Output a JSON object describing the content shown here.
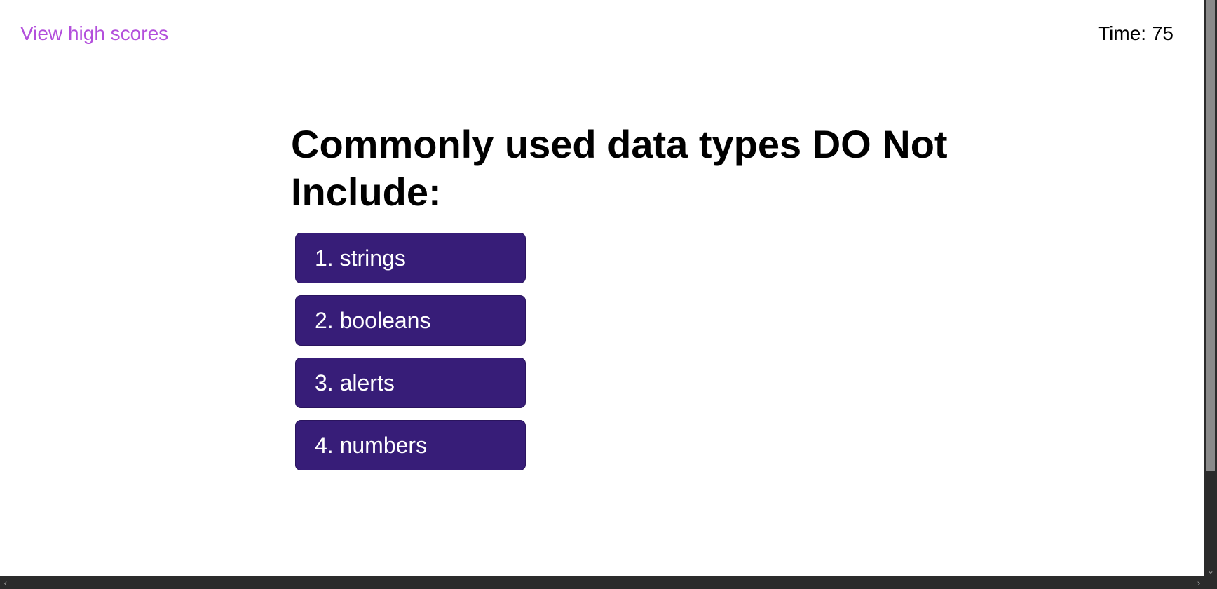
{
  "header": {
    "high_scores_link": "View high scores",
    "timer_label": "Time:",
    "timer_value": "75"
  },
  "quiz": {
    "question": "Commonly used data types DO Not Include:",
    "answers": [
      {
        "label": "1. strings"
      },
      {
        "label": "2. booleans"
      },
      {
        "label": "3. alerts"
      },
      {
        "label": "4. numbers"
      }
    ]
  },
  "scrollbars": {
    "vertical_icon_up": "chevron-up-icon",
    "vertical_icon_down": "chevron-down-icon",
    "horizontal_icon_left": "chevron-left-icon",
    "horizontal_icon_right": "chevron-right-icon"
  },
  "colors": {
    "link": "#b34fdc",
    "button_bg": "#371d78",
    "button_text": "#ffffff",
    "scrollbar_bg": "#2b2b2b"
  }
}
